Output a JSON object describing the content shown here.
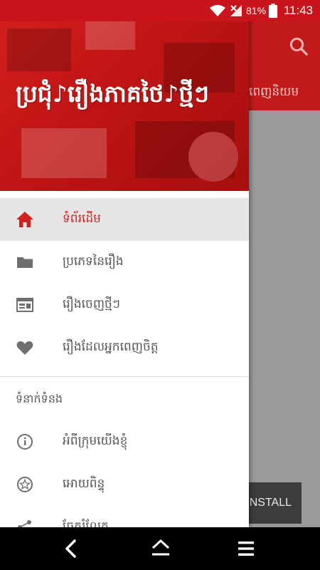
{
  "status_bar": {
    "battery_percent": "81%",
    "time": "11:43",
    "icons": [
      "wifi-icon",
      "signal-icon",
      "battery-icon"
    ]
  },
  "app": {
    "tab_partial": "ពេញនិយម",
    "install_label": "NSTALL",
    "toolbar_color": "#c21a1a"
  },
  "drawer": {
    "header_title": "ប្រជុំ♪រឿងភាគថៃ♪ថ្មីៗ",
    "menu": [
      {
        "label": "ទំព័រដើម",
        "icon": "home-icon",
        "active": true
      },
      {
        "label": "ប្រភេទនៃរឿង",
        "icon": "folder-icon",
        "active": false
      },
      {
        "label": "រឿងចេញថ្មីៗ",
        "icon": "new-releases-icon",
        "active": false
      },
      {
        "label": "រឿងដែលអ្នកពេញចិត្ត",
        "icon": "heart-icon",
        "active": false
      }
    ],
    "section_title": "ទំនាក់ទំនង",
    "contact_menu": [
      {
        "label": "អំពីក្រុមយើងខ្ញុំ",
        "icon": "info-icon"
      },
      {
        "label": "អោយពិន្ទុ",
        "icon": "star-icon"
      },
      {
        "label": "ចែករំលែក",
        "icon": "share-icon"
      }
    ]
  },
  "colors": {
    "accent": "#d32020",
    "statusbar": "#c8141a"
  },
  "nav_bar": {
    "icons": [
      "back-icon",
      "home-icon",
      "menu-icon"
    ]
  }
}
